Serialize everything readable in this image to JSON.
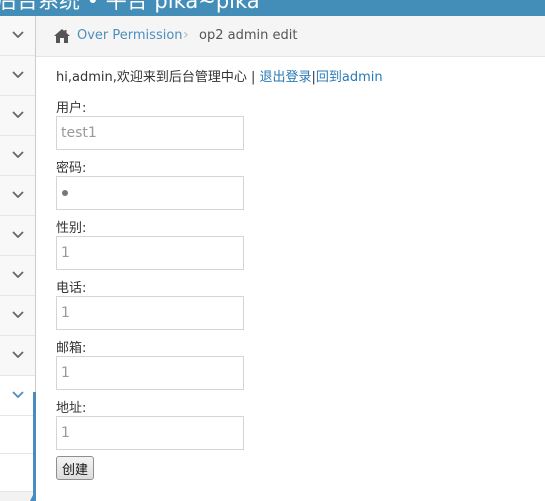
{
  "topbar": {
    "brand_text": "后台系统 • 平台 pika~pika"
  },
  "breadcrumb": {
    "home_link": "Over Permission",
    "separator": "›",
    "current": "op2 admin edit"
  },
  "welcome": {
    "prefix": "hi,admin,欢迎来到后台管理中心 | ",
    "logout_link": "退出登录",
    "divider": "|",
    "back_link": "回到admin"
  },
  "form": {
    "username": {
      "label": "用户:",
      "value": "test1"
    },
    "password": {
      "label": "密码:",
      "value": ""
    },
    "gender": {
      "label": "性别:",
      "value": "1"
    },
    "phone": {
      "label": "电话:",
      "value": "1"
    },
    "email": {
      "label": "邮箱:",
      "value": "1"
    },
    "address": {
      "label": "地址:",
      "value": "1"
    },
    "submit_label": "创建"
  },
  "icons": {
    "home": "home-icon",
    "chevron": "chevron-down-icon"
  },
  "colors": {
    "topbar": "#438eb9",
    "link": "#4c8fbd",
    "active": "#4a8bc2"
  }
}
